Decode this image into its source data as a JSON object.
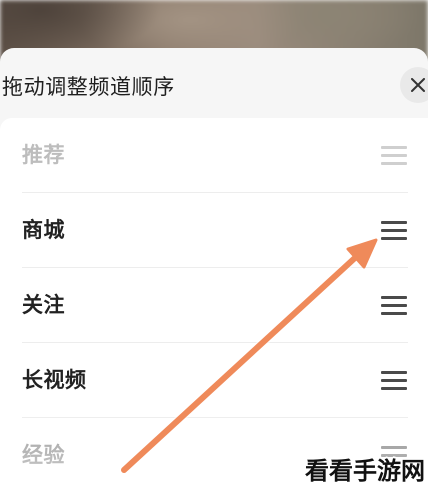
{
  "sheet": {
    "title": "拖动调整频道顺序",
    "close_icon": "close-icon"
  },
  "channels": [
    {
      "label": "推荐",
      "disabled": true
    },
    {
      "label": "商城",
      "disabled": false
    },
    {
      "label": "关注",
      "disabled": false
    },
    {
      "label": "长视频",
      "disabled": false
    },
    {
      "label": "经验",
      "disabled": false
    }
  ],
  "drag_icon": "drag-handle-icon",
  "annotation": {
    "icon": "arrow-icon",
    "color": "#ef8a5a"
  },
  "watermark": {
    "text": "看看手游网"
  },
  "colors": {
    "sheet_background": "#f6f6f6",
    "card_background": "#ffffff",
    "text": "#222222",
    "disabled_text": "#bdbdbd"
  }
}
